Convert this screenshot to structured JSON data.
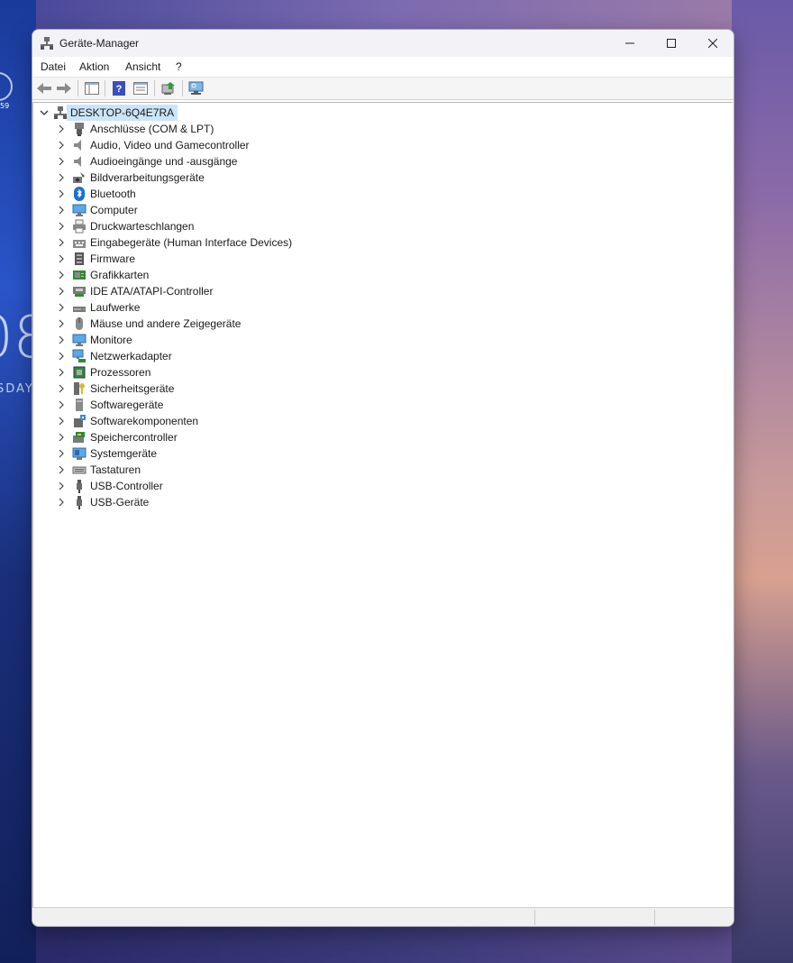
{
  "window": {
    "title": "Geräte-Manager"
  },
  "menu": [
    {
      "label": "Datei"
    },
    {
      "label": "Aktion"
    },
    {
      "label": "Ansicht"
    },
    {
      "label": "?"
    }
  ],
  "toolbar": {
    "buttons": [
      "back-icon",
      "forward-icon",
      "properties-view-icon",
      "help-icon",
      "details-icon",
      "update-driver-icon",
      "scan-hardware-icon"
    ]
  },
  "tree": {
    "root": {
      "label": "DESKTOP-6Q4E7RA",
      "icon": "computer-network-icon"
    },
    "items": [
      {
        "label": "Anschlüsse (COM & LPT)",
        "icon": "port-icon"
      },
      {
        "label": "Audio, Video und Gamecontroller",
        "icon": "speaker-icon"
      },
      {
        "label": "Audioeingänge und -ausgänge",
        "icon": "speaker-icon"
      },
      {
        "label": "Bildverarbeitungsgeräte",
        "icon": "camera-icon"
      },
      {
        "label": "Bluetooth",
        "icon": "bluetooth-icon"
      },
      {
        "label": "Computer",
        "icon": "monitor-icon"
      },
      {
        "label": "Druckwarteschlangen",
        "icon": "printer-icon"
      },
      {
        "label": "Eingabegeräte (Human Interface Devices)",
        "icon": "hid-icon"
      },
      {
        "label": "Firmware",
        "icon": "firmware-icon"
      },
      {
        "label": "Grafikkarten",
        "icon": "display-adapter-icon"
      },
      {
        "label": "IDE ATA/ATAPI-Controller",
        "icon": "ide-controller-icon"
      },
      {
        "label": "Laufwerke",
        "icon": "disk-drive-icon"
      },
      {
        "label": "Mäuse und andere Zeigegeräte",
        "icon": "mouse-icon"
      },
      {
        "label": "Monitore",
        "icon": "monitor-icon"
      },
      {
        "label": "Netzwerkadapter",
        "icon": "network-adapter-icon"
      },
      {
        "label": "Prozessoren",
        "icon": "processor-icon"
      },
      {
        "label": "Sicherheitsgeräte",
        "icon": "security-key-icon"
      },
      {
        "label": "Softwaregeräte",
        "icon": "software-device-icon"
      },
      {
        "label": "Softwarekomponenten",
        "icon": "software-component-icon"
      },
      {
        "label": "Speichercontroller",
        "icon": "storage-controller-icon"
      },
      {
        "label": "Systemgeräte",
        "icon": "system-device-icon"
      },
      {
        "label": "Tastaturen",
        "icon": "keyboard-icon"
      },
      {
        "label": "USB-Controller",
        "icon": "usb-icon"
      },
      {
        "label": "USB-Geräte",
        "icon": "usb-icon"
      }
    ]
  },
  "desktop": {
    "widget_digits": "08",
    "widget_day": "SDAY",
    "widget_small": "59"
  },
  "colors": {
    "selection": "#cce4f7",
    "window_bg": "#ffffff",
    "titlebar_bg": "#f2f2f7"
  }
}
